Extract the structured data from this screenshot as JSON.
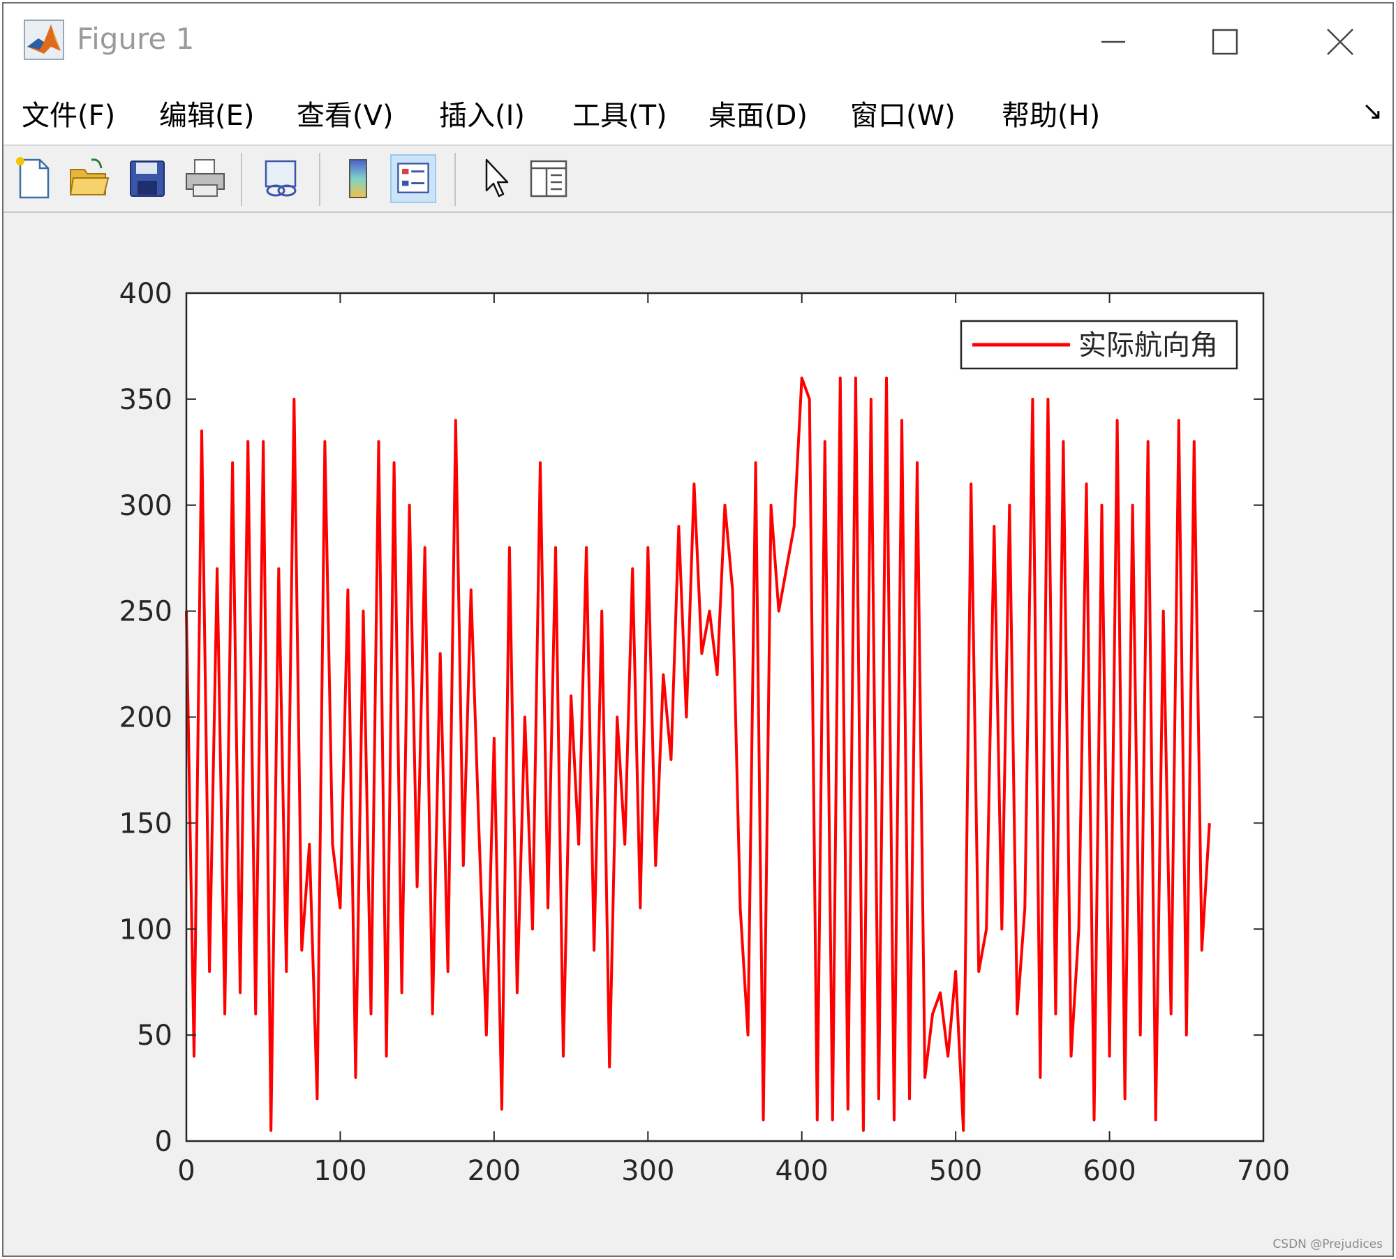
{
  "window": {
    "title": "Figure 1",
    "watermark": "CSDN @Prejudices"
  },
  "menubar": {
    "items": [
      {
        "label": "文件(F)"
      },
      {
        "label": "编辑(E)"
      },
      {
        "label": "查看(V)"
      },
      {
        "label": "插入(I)"
      },
      {
        "label": "工具(T)"
      },
      {
        "label": "桌面(D)"
      },
      {
        "label": "窗口(W)"
      },
      {
        "label": "帮助(H)"
      }
    ],
    "overflow_icon": "dock-arrow-icon"
  },
  "toolbar": {
    "tools": [
      {
        "icon": "new-figure-icon"
      },
      {
        "icon": "open-file-icon"
      },
      {
        "icon": "save-icon"
      },
      {
        "icon": "print-icon"
      },
      {
        "icon": "link-plot-icon"
      },
      {
        "icon": "insert-colorbar-icon"
      },
      {
        "icon": "insert-legend-icon",
        "active": true
      },
      {
        "icon": "edit-plot-pointer-icon"
      },
      {
        "icon": "property-inspector-icon"
      }
    ]
  },
  "chart_data": {
    "type": "line",
    "title": "",
    "xlabel": "",
    "ylabel": "",
    "xlim": [
      0,
      700
    ],
    "ylim": [
      0,
      400
    ],
    "xticks": [
      "0",
      "100",
      "200",
      "300",
      "400",
      "500",
      "600",
      "700"
    ],
    "yticks": [
      "0",
      "50",
      "100",
      "150",
      "200",
      "250",
      "300",
      "350",
      "400"
    ],
    "grid": false,
    "legend_position": "top-right",
    "series": [
      {
        "name": "实际航向角",
        "color": "#ff0000",
        "x_range": [
          0,
          665
        ],
        "x": [
          0,
          5,
          10,
          15,
          20,
          25,
          30,
          35,
          40,
          45,
          50,
          55,
          60,
          65,
          70,
          75,
          80,
          85,
          90,
          95,
          100,
          105,
          110,
          115,
          120,
          125,
          130,
          135,
          140,
          145,
          150,
          155,
          160,
          165,
          170,
          175,
          180,
          185,
          190,
          195,
          200,
          205,
          210,
          215,
          220,
          225,
          230,
          235,
          240,
          245,
          250,
          255,
          260,
          265,
          270,
          275,
          280,
          285,
          290,
          295,
          300,
          305,
          310,
          315,
          320,
          325,
          330,
          335,
          340,
          345,
          350,
          355,
          360,
          365,
          370,
          375,
          380,
          385,
          390,
          395,
          400,
          405,
          410,
          415,
          420,
          425,
          430,
          435,
          440,
          445,
          450,
          455,
          460,
          465,
          470,
          475,
          480,
          485,
          490,
          495,
          500,
          505,
          510,
          515,
          520,
          525,
          530,
          535,
          540,
          545,
          550,
          555,
          560,
          565,
          570,
          575,
          580,
          585,
          590,
          595,
          600,
          605,
          610,
          615,
          620,
          625,
          630,
          635,
          640,
          645,
          650,
          655,
          660,
          665
        ],
        "y": [
          250,
          40,
          335,
          80,
          270,
          60,
          320,
          70,
          330,
          60,
          330,
          5,
          270,
          80,
          350,
          90,
          140,
          20,
          330,
          140,
          110,
          260,
          30,
          250,
          60,
          330,
          40,
          320,
          70,
          300,
          120,
          280,
          60,
          230,
          80,
          340,
          130,
          260,
          150,
          50,
          190,
          15,
          280,
          70,
          200,
          100,
          320,
          110,
          280,
          40,
          210,
          140,
          280,
          90,
          250,
          35,
          200,
          140,
          270,
          110,
          280,
          130,
          220,
          180,
          290,
          200,
          310,
          230,
          250,
          220,
          300,
          260,
          110,
          50,
          320,
          10,
          300,
          250,
          270,
          290,
          360,
          350,
          10,
          330,
          10,
          360,
          15,
          360,
          5,
          350,
          20,
          360,
          10,
          340,
          20,
          320,
          30,
          60,
          70,
          40,
          80,
          5,
          310,
          80,
          100,
          290,
          100,
          300,
          60,
          110,
          350,
          30,
          350,
          60,
          330,
          40,
          100,
          310,
          10,
          300,
          40,
          340,
          20,
          300,
          50,
          330,
          10,
          250,
          60,
          340,
          50,
          330,
          90,
          150
        ]
      }
    ]
  }
}
